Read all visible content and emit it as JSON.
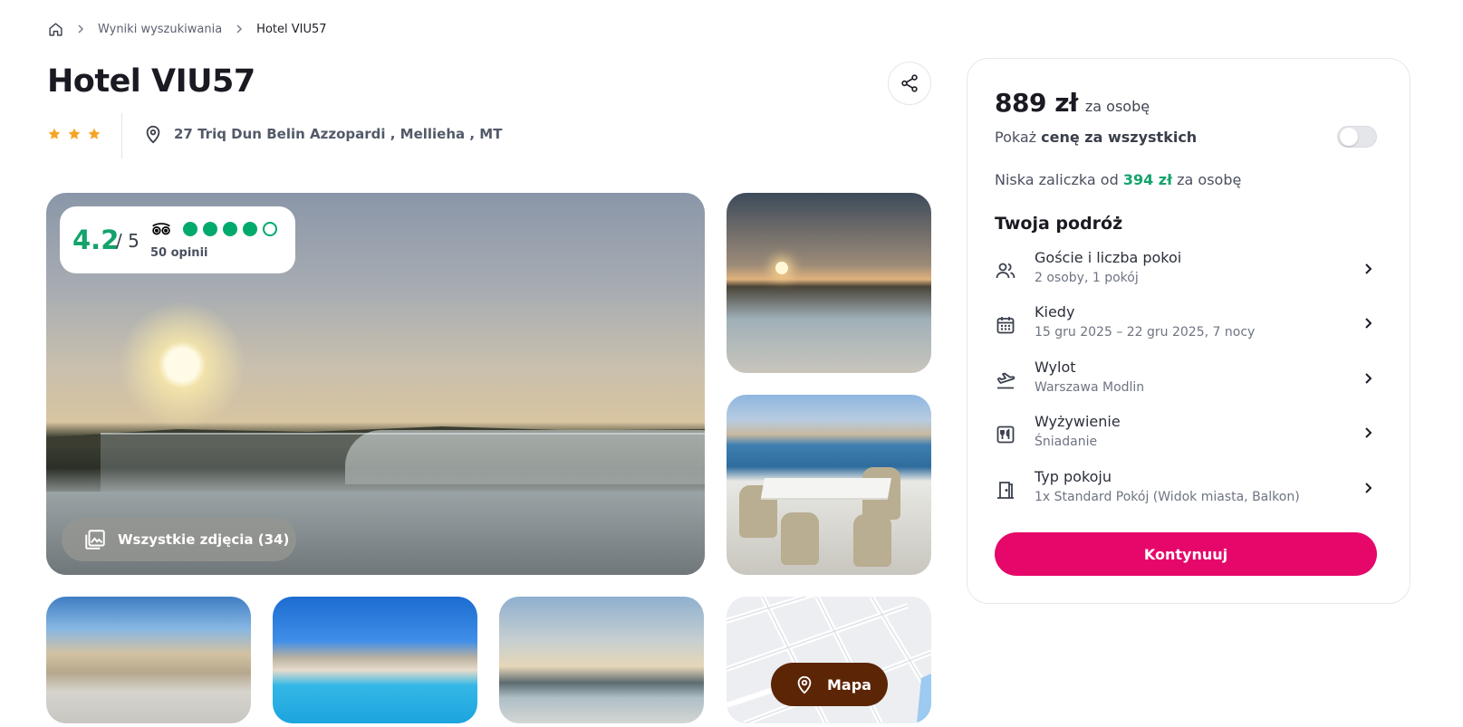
{
  "breadcrumb": {
    "home_icon": "home-icon",
    "items": [
      "Wyniki wyszukiwania",
      "Hotel VIU57"
    ]
  },
  "hotel": {
    "name": "Hotel VIU57",
    "stars": 3,
    "address": "27 Triq Dun Belin Azzopardi , Mellieha , MT"
  },
  "rating": {
    "score": "4.2",
    "max": "/ 5",
    "bubbles_filled": 4,
    "bubbles_total": 5,
    "reviews": "50 opinii",
    "color": "#00aa6c"
  },
  "gallery": {
    "all_photos_label": "Wszystkie zdjęcia (34)",
    "map_label": "Mapa"
  },
  "booking": {
    "price_value": "889 zł",
    "price_unit": "za osobę",
    "show_all_prefix": "Pokaż ",
    "show_all_bold": "cenę za wszystkich",
    "toggle_on": false,
    "deposit_prefix": "Niska zaliczka od ",
    "deposit_amount": "394 zł",
    "deposit_suffix": " za osobę",
    "trip_title": "Twoja podróż",
    "trip_items": [
      {
        "icon": "guests-icon",
        "label": "Goście i liczba pokoi",
        "value": "2 osoby, 1 pokój"
      },
      {
        "icon": "calendar-icon",
        "label": "Kiedy",
        "value": "15 gru 2025 – 22 gru 2025, 7 nocy"
      },
      {
        "icon": "plane-departure-icon",
        "label": "Wylot",
        "value": "Warszawa Modlin"
      },
      {
        "icon": "meals-icon",
        "label": "Wyżywienie",
        "value": "Śniadanie"
      },
      {
        "icon": "room-door-icon",
        "label": "Typ pokoju",
        "value": "1x Standard Pokój (Widok miasta, Balkon)"
      }
    ],
    "continue_label": "Kontynuuj",
    "accent_color": "#e6076a"
  }
}
